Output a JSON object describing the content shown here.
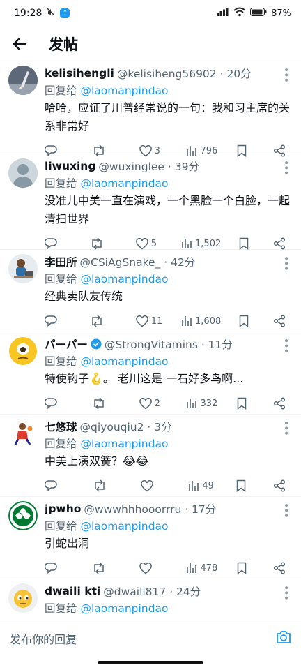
{
  "status": {
    "time": "19:28",
    "battery": "87%"
  },
  "header": {
    "title": "发帖"
  },
  "replies": [
    {
      "name": "kelisihengli",
      "handle": "@kelisiheng56902 · 20分",
      "replying": "回复给",
      "mention": "@laomanpindao",
      "text": "哈哈，应证了川普经常说的一句：我和习主席的关系非常好",
      "likes": "3",
      "views": "796"
    },
    {
      "name": "liwuxing",
      "handle": "@wuxinglee · 39分",
      "replying": "回复给",
      "mention": "@laomanpindao",
      "text": "没准儿中美一直在演戏，一个黑脸一个白脸，一起清扫世界",
      "likes": "5",
      "views": "1,502"
    },
    {
      "name": "李田所",
      "handle": "@CSiAgSnake_ · 42分",
      "replying": "回复给",
      "mention": "@laomanpindao",
      "text": "经典卖队友传统",
      "likes": "11",
      "views": "1,608"
    },
    {
      "name": "パーパー",
      "handle": "@StrongVitamins · 11分",
      "replying": "回复给",
      "mention": "@laomanpindao",
      "text": "特使钩子🪝。 老川这是 一石好多鸟啊...",
      "likes": "2",
      "views": "332"
    },
    {
      "name": "七悠球",
      "handle": "@qiyouqiu2 · 3分",
      "replying": "回复给",
      "mention": "@laomanpindao",
      "text": "中美上演双簧？😂😂",
      "likes": "",
      "views": "49"
    },
    {
      "name": "jpwho",
      "handle": "@wwwhhhooorrru · 17分",
      "replying": "回复给",
      "mention": "@laomanpindao",
      "text": "引蛇出洞",
      "likes": "",
      "views": "478"
    },
    {
      "name": "dwaili kti",
      "handle": "@dwaili817 · 24分",
      "replying": "回复给",
      "mention": "@laomanpindao",
      "text": "",
      "likes": "",
      "views": ""
    }
  ],
  "composer": {
    "placeholder": "发布你的回复"
  },
  "colors": {
    "accent": "#1d9bf0",
    "secondary": "#536471",
    "verified": "#1d9bf0"
  }
}
